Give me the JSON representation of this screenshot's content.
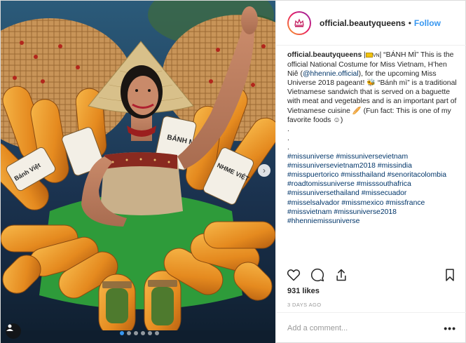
{
  "post": {
    "username": "official.beautyqueens",
    "separator": "•",
    "follow_label": "Follow",
    "avatar_icon": "beautyqueens-crown-logo"
  },
  "caption": {
    "username": "official.beautyqueens",
    "intro_flag": "VN",
    "intro_text": "“BÁNH MÌ” This is the official National Costume for Miss Vietnam, H’hen Niê (",
    "mention": "@hhennie.official",
    "text_2": "), for the upcoming Miss Universe 2018 pageant! 🐝 “Bánh mì” is a traditional Vietnamese sandwich that is served on a baguette with meat and vegetables and is an important part of Vietnamese cuisine 🥖 (Fun fact: This is one of my favorite foods ☺)",
    "dot_lines": [
      ".",
      ".",
      "."
    ],
    "hashtags": [
      "#missuniverse",
      "#missuniversevietnam",
      "#missuniversevietnam2018",
      "#missindia",
      "#misspuertorico",
      "#missthailand",
      "#senoritacolombia",
      "#roadtomissuniverse",
      "#misssouthafrica",
      "#missuniversethailand",
      "#missecuador",
      "#misselsalvador",
      "#missmexico",
      "#missfrance",
      "#missvietnam",
      "#missuniverse2018",
      "#hhenniemissuniverse"
    ]
  },
  "media": {
    "photo_description": "",
    "carousel_count": 6,
    "carousel_active": 1,
    "bread_label_top": "BÁNH MÌ",
    "bread_label_left": "Bánh Việt",
    "bread_label_right": "NHME VIỆT"
  },
  "actions": {
    "like_icon": "heart-icon",
    "comment_icon": "comment-icon",
    "share_icon": "share-icon",
    "save_icon": "bookmark-icon"
  },
  "likes": "931 likes",
  "timestamp": "3 DAYS AGO",
  "comment": {
    "placeholder": "Add a comment...",
    "more_label": "•••"
  },
  "colors": {
    "accent": "#3897f0",
    "link": "#003569",
    "text": "#262626",
    "muted": "#999999"
  }
}
